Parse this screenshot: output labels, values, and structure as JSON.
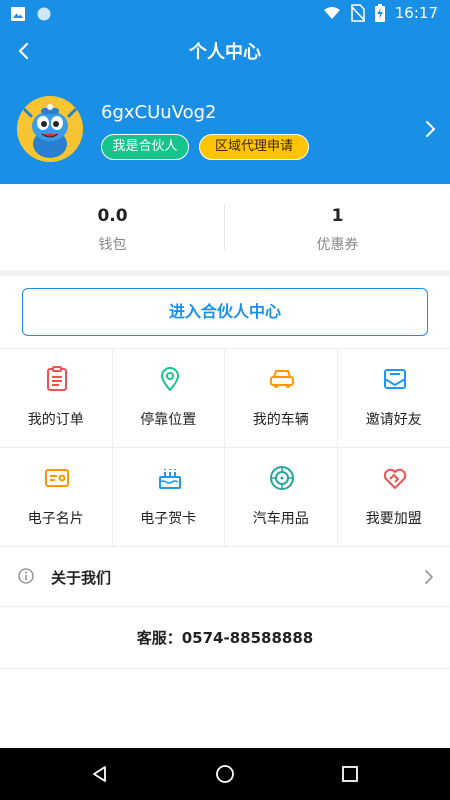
{
  "status_bar": {
    "time": "16:17"
  },
  "header": {
    "title": "个人中心"
  },
  "profile": {
    "username": "6gxCUuVog2",
    "tags": {
      "partner": "我是合伙人",
      "agent": "区域代理申请"
    }
  },
  "stats": {
    "wallet": {
      "value": "0.0",
      "label": "钱包"
    },
    "coupons": {
      "value": "1",
      "label": "优惠券"
    }
  },
  "partner_button": "进入合伙人中心",
  "grid": [
    {
      "label": "我的订单",
      "icon": "order-icon"
    },
    {
      "label": "停靠位置",
      "icon": "location-icon"
    },
    {
      "label": "我的车辆",
      "icon": "car-icon"
    },
    {
      "label": "邀请好友",
      "icon": "mail-icon"
    },
    {
      "label": "电子名片",
      "icon": "card-icon"
    },
    {
      "label": "电子贺卡",
      "icon": "cake-icon"
    },
    {
      "label": "汽车用品",
      "icon": "wheel-icon"
    },
    {
      "label": "我要加盟",
      "icon": "handshake-icon"
    }
  ],
  "about": {
    "label": "关于我们"
  },
  "service": {
    "text": "客服：0574-88588888"
  },
  "colors": {
    "brand": "#1a8fe6",
    "partner_tag": "#17c48c",
    "agent_tag": "#ffc400"
  }
}
